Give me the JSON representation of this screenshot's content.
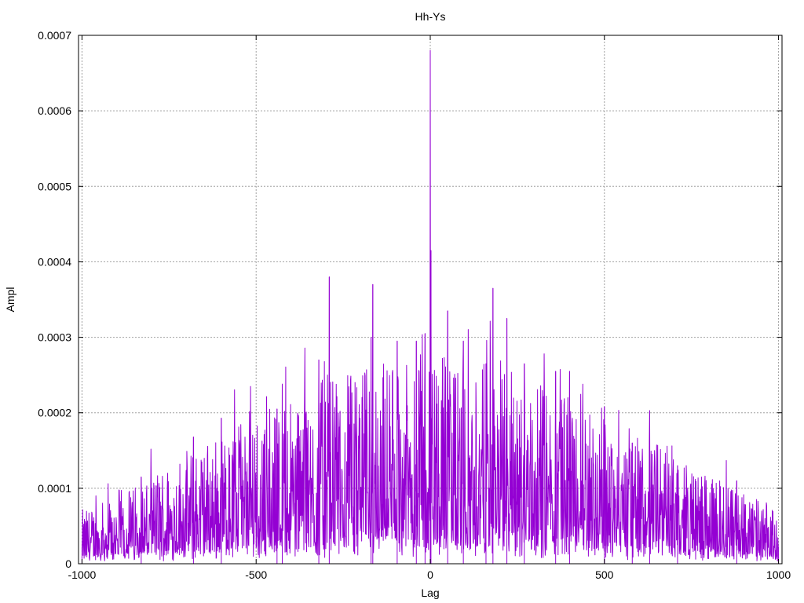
{
  "chart_data": {
    "type": "line",
    "title": "Hh-Ys",
    "xlabel": "Lag",
    "ylabel": "Ampl",
    "xlim": [
      -1010,
      1010
    ],
    "ylim": [
      0,
      0.0007
    ],
    "x_ticks": [
      -1000,
      -500,
      0,
      500,
      1000
    ],
    "x_tick_labels": [
      "-1000",
      "-500",
      "0",
      "500",
      "1000"
    ],
    "y_ticks": [
      0,
      0.0001,
      0.0002,
      0.0003,
      0.0004,
      0.0005,
      0.0006,
      0.0007
    ],
    "y_tick_labels": [
      "0",
      "0.0001",
      "0.0002",
      "0.0003",
      "0.0004",
      "0.0005",
      "0.0006",
      "0.0007"
    ],
    "grid": true,
    "line_color": "#9400d3",
    "series": [
      {
        "name": "",
        "notable_peaks": [
          {
            "x": 0,
            "y": 0.00068
          },
          {
            "x": 2,
            "y": 0.000415
          },
          {
            "x": -290,
            "y": 0.00038
          },
          {
            "x": -165,
            "y": 0.00037
          },
          {
            "x": 180,
            "y": 0.000365
          },
          {
            "x": 50,
            "y": 0.000335
          },
          {
            "x": 220,
            "y": 0.000325
          },
          {
            "x": -320,
            "y": 0.00027
          },
          {
            "x": -170,
            "y": 0.0003
          },
          {
            "x": -95,
            "y": 0.000295
          },
          {
            "x": -40,
            "y": 0.000295
          },
          {
            "x": -15,
            "y": 0.000305
          },
          {
            "x": 95,
            "y": 0.000295
          },
          {
            "x": 160,
            "y": 0.000265
          },
          {
            "x": 270,
            "y": 0.000265
          },
          {
            "x": 360,
            "y": 0.000255
          },
          {
            "x": 400,
            "y": 0.000255
          },
          {
            "x": -425,
            "y": 0.000238
          },
          {
            "x": -440,
            "y": 0.000205
          },
          {
            "x": 500,
            "y": 0.000208
          },
          {
            "x": 630,
            "y": 0.000203
          },
          {
            "x": -600,
            "y": 0.000193
          },
          {
            "x": -680,
            "y": 0.000168
          },
          {
            "x": 580,
            "y": 0.00016
          },
          {
            "x": -830,
            "y": 0.000115
          },
          {
            "x": 710,
            "y": 0.00013
          },
          {
            "x": 880,
            "y": 0.00011
          },
          {
            "x": -1000,
            "y": 2e-05
          },
          {
            "x": 1000,
            "y": 2e-05
          }
        ],
        "envelope": [
          {
            "x": -1000,
            "y": 4e-05
          },
          {
            "x": -800,
            "y": 7e-05
          },
          {
            "x": -600,
            "y": 0.0001
          },
          {
            "x": -400,
            "y": 0.00013
          },
          {
            "x": -200,
            "y": 0.00015
          },
          {
            "x": 0,
            "y": 0.00016
          },
          {
            "x": 200,
            "y": 0.00015
          },
          {
            "x": 400,
            "y": 0.00013
          },
          {
            "x": 600,
            "y": 0.0001
          },
          {
            "x": 800,
            "y": 7e-05
          },
          {
            "x": 1000,
            "y": 4e-05
          }
        ]
      }
    ]
  }
}
